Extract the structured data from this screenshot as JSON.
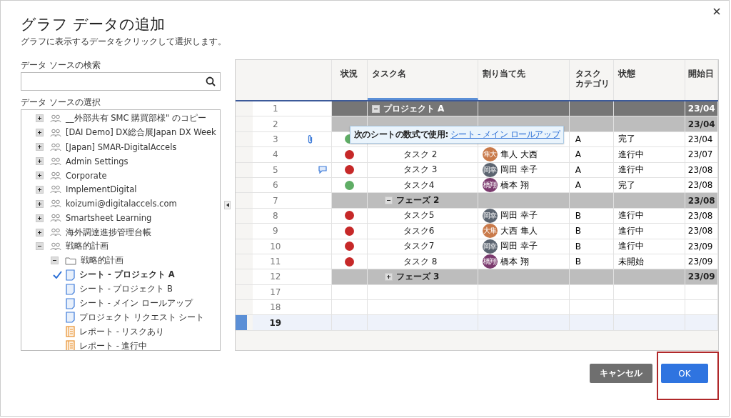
{
  "dialog": {
    "title": "グラフ データの追加",
    "subtitle": "グラフに表示するデータをクリックして選択します。"
  },
  "search": {
    "label": "データ ソースの検索"
  },
  "source_tree": {
    "label": "データ ソースの選択",
    "items": [
      {
        "kind": "workspace",
        "label": "__外部共有 SMC 購買部様\" のコピー",
        "expanded": false
      },
      {
        "kind": "workspace",
        "label": "[DAI Demo] DX総合展Japan DX Week",
        "expanded": false
      },
      {
        "kind": "workspace",
        "label": "[Japan] SMAR-DigitalAccels",
        "expanded": false
      },
      {
        "kind": "workspace",
        "label": "Admin Settings",
        "expanded": false
      },
      {
        "kind": "workspace",
        "label": "Corporate",
        "expanded": false
      },
      {
        "kind": "workspace",
        "label": "ImplementDigital",
        "expanded": false
      },
      {
        "kind": "workspace",
        "label": "koizumi@digitalaccels.com",
        "expanded": false
      },
      {
        "kind": "workspace",
        "label": "Smartsheet Learning",
        "expanded": false
      },
      {
        "kind": "workspace",
        "label": "海外調達進捗管理台帳",
        "expanded": false
      },
      {
        "kind": "workspace",
        "label": "戦略的計画",
        "expanded": true,
        "children": [
          {
            "kind": "folder",
            "label": "戦略的計画",
            "expanded": true,
            "children": [
              {
                "kind": "sheet",
                "label": "シート - プロジェクト A",
                "selected": true
              },
              {
                "kind": "sheet",
                "label": "シート - プロジェクト B",
                "selected": false
              },
              {
                "kind": "sheet",
                "label": "シート - メイン ロールアップ",
                "selected": false
              },
              {
                "kind": "sheet",
                "label": "プロジェクト リクエスト シート",
                "selected": false
              },
              {
                "kind": "report",
                "label": "レポート - リスクあり",
                "selected": false
              },
              {
                "kind": "report",
                "label": "レポート - 進行中",
                "selected": false
              }
            ]
          }
        ]
      }
    ]
  },
  "grid": {
    "columns": [
      [
        "状況"
      ],
      [
        "タスク名"
      ],
      [
        "割り当て先"
      ],
      [
        "タスク",
        "カテゴリ"
      ],
      [
        "状態"
      ],
      [
        "開始日"
      ]
    ],
    "rows": [
      {
        "num": "1",
        "kind": "project",
        "task": "プロジェクト A",
        "expanded": true,
        "start": "23/04"
      },
      {
        "num": "2",
        "kind": "phase",
        "start": "23/04"
      },
      {
        "num": "3",
        "kind": "task",
        "attachment": true,
        "status": {
          "color": "#5fad65"
        },
        "category": "A",
        "state": "完了",
        "start": "23/04"
      },
      {
        "num": "4",
        "kind": "task",
        "status": {
          "color": "#c62828"
        },
        "task": "タスク 2",
        "assignee": {
          "initials": "隼大",
          "name": "隼人 大西",
          "color": "#c97a4a"
        },
        "category": "A",
        "state": "進行中",
        "start": "23/07"
      },
      {
        "num": "5",
        "kind": "task",
        "comment": true,
        "status": {
          "color": "#c62828"
        },
        "task": "タスク 3",
        "assignee": {
          "initials": "岡幸",
          "name": "岡田 幸子",
          "color": "#5b6470"
        },
        "category": "A",
        "state": "進行中",
        "start": "23/08"
      },
      {
        "num": "6",
        "kind": "task",
        "status": {
          "color": "#5fad65"
        },
        "task": "タスク4",
        "assignee": {
          "initials": "橋翔",
          "name": "橋本 翔",
          "color": "#7b3a6e"
        },
        "category": "A",
        "state": "完了",
        "start": "23/08"
      },
      {
        "num": "7",
        "kind": "phase",
        "task": "フェーズ 2",
        "expanded": true,
        "start": "23/08"
      },
      {
        "num": "8",
        "kind": "task",
        "status": {
          "color": "#c62828"
        },
        "task": "タスク5",
        "assignee": {
          "initials": "岡幸",
          "name": "岡田 幸子",
          "color": "#5b6470"
        },
        "category": "B",
        "state": "進行中",
        "start": "23/08"
      },
      {
        "num": "9",
        "kind": "task",
        "status": {
          "color": "#c62828"
        },
        "task": "タスク6",
        "assignee": {
          "initials": "大隼",
          "name": "大西 隼人",
          "color": "#c97a4a"
        },
        "category": "B",
        "state": "進行中",
        "start": "23/08"
      },
      {
        "num": "10",
        "kind": "task",
        "status": {
          "color": "#c62828"
        },
        "task": "タスク7",
        "assignee": {
          "initials": "岡幸",
          "name": "岡田 幸子",
          "color": "#5b6470"
        },
        "category": "B",
        "state": "進行中",
        "start": "23/09"
      },
      {
        "num": "11",
        "kind": "task",
        "status": {
          "color": "#c62828"
        },
        "task": "タスク 8",
        "assignee": {
          "initials": "橋翔",
          "name": "橋本 翔",
          "color": "#7b3a6e"
        },
        "category": "B",
        "state": "未開始",
        "start": "23/09"
      },
      {
        "num": "12",
        "kind": "phase",
        "task": "フェーズ 3",
        "expanded": false,
        "start": "23/09"
      },
      {
        "num": "17",
        "kind": "empty"
      },
      {
        "num": "18",
        "kind": "empty"
      },
      {
        "num": "19",
        "kind": "empty",
        "selected": true
      }
    ],
    "tooltip": {
      "text": "次のシートの数式で使用:",
      "link": "シート - メイン ロールアップ"
    }
  },
  "buttons": [
    {
      "kind": "secondary",
      "label": "キャンセル"
    },
    {
      "kind": "primary",
      "label": "OK",
      "highlighted": true
    }
  ]
}
